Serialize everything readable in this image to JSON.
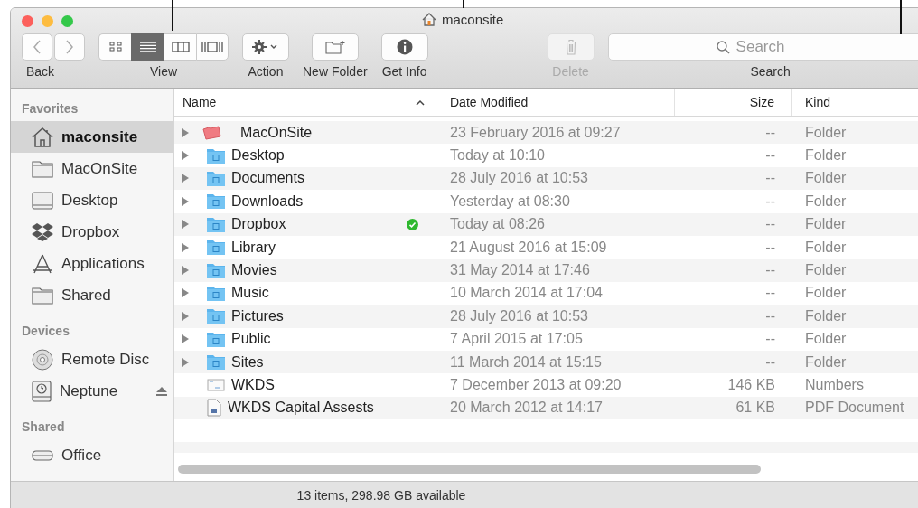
{
  "window": {
    "title": "maconsite"
  },
  "toolbar": {
    "back_label": "Back",
    "view_label": "View",
    "view_modes": [
      {
        "kind": "icons",
        "selected": false
      },
      {
        "kind": "list",
        "selected": true
      },
      {
        "kind": "columns",
        "selected": false
      },
      {
        "kind": "coverflow",
        "selected": false
      }
    ],
    "action_label": "Action",
    "new_folder_label": "New Folder",
    "get_info_label": "Get Info",
    "delete_label": "Delete",
    "delete_disabled": true,
    "search": {
      "placeholder": "Search",
      "label": "Search"
    }
  },
  "sidebar": [
    {
      "heading": "Favorites",
      "items": [
        {
          "label": "maconsite",
          "kind": "home",
          "selected": true
        },
        {
          "label": "MacOnSite",
          "kind": "folder",
          "selected": false
        },
        {
          "label": "Desktop",
          "kind": "desktop",
          "selected": false
        },
        {
          "label": "Dropbox",
          "kind": "dropbox",
          "selected": false
        },
        {
          "label": "Applications",
          "kind": "apps",
          "selected": false
        },
        {
          "label": "Shared",
          "kind": "folder",
          "selected": false
        }
      ]
    },
    {
      "heading": "Devices",
      "items": [
        {
          "label": "Remote Disc",
          "kind": "disc",
          "selected": false
        },
        {
          "label": "Neptune",
          "kind": "timemachine",
          "selected": false,
          "ejectable": true
        }
      ]
    },
    {
      "heading": "Shared",
      "items": [
        {
          "label": "Office",
          "kind": "server",
          "selected": false
        }
      ]
    }
  ],
  "table": {
    "columns": [
      "Name",
      "Date Modified",
      "Size",
      "Kind"
    ],
    "sort_ascending": true,
    "rows": [
      {
        "name": "MacOnSite",
        "kind": "redfolder",
        "expandable": true,
        "date": "23 February 2016 at 09:27",
        "size": "--",
        "kind_text": "Folder"
      },
      {
        "name": "Desktop",
        "kind": "folder",
        "expandable": true,
        "date": "Today at 10:10",
        "size": "--",
        "kind_text": "Folder"
      },
      {
        "name": "Documents",
        "kind": "folder",
        "expandable": true,
        "date": "28 July 2016 at 10:53",
        "size": "--",
        "kind_text": "Folder"
      },
      {
        "name": "Downloads",
        "kind": "folder",
        "expandable": true,
        "date": "Yesterday at 08:30",
        "size": "--",
        "kind_text": "Folder"
      },
      {
        "name": "Dropbox",
        "kind": "folder",
        "expandable": true,
        "synced": true,
        "date": "Today at 08:26",
        "size": "--",
        "kind_text": "Folder"
      },
      {
        "name": "Library",
        "kind": "folder",
        "expandable": true,
        "date": "21 August 2016 at 15:09",
        "size": "--",
        "kind_text": "Folder"
      },
      {
        "name": "Movies",
        "kind": "folder",
        "expandable": true,
        "date": "31 May 2014 at 17:46",
        "size": "--",
        "kind_text": "Folder"
      },
      {
        "name": "Music",
        "kind": "folder",
        "expandable": true,
        "date": "10 March 2014 at 17:04",
        "size": "--",
        "kind_text": "Folder"
      },
      {
        "name": "Pictures",
        "kind": "folder",
        "expandable": true,
        "date": "28 July 2016 at 10:53",
        "size": "--",
        "kind_text": "Folder"
      },
      {
        "name": "Public",
        "kind": "folder",
        "expandable": true,
        "date": "7 April 2015 at 17:05",
        "size": "--",
        "kind_text": "Folder"
      },
      {
        "name": "Sites",
        "kind": "folder",
        "expandable": true,
        "date": "11 March 2014 at 15:15",
        "size": "--",
        "kind_text": "Folder"
      },
      {
        "name": "WKDS",
        "kind": "spreadsheet",
        "expandable": false,
        "date": "7 December 2013 at 09:20",
        "size": "146 KB",
        "kind_text": "Numbers"
      },
      {
        "name": "WKDS Capital Assests",
        "kind": "pdf",
        "expandable": false,
        "date": "20 March 2012 at 14:17",
        "size": "61 KB",
        "kind_text": "PDF Document"
      }
    ]
  },
  "status_bar": "13 items, 298.98 GB available"
}
